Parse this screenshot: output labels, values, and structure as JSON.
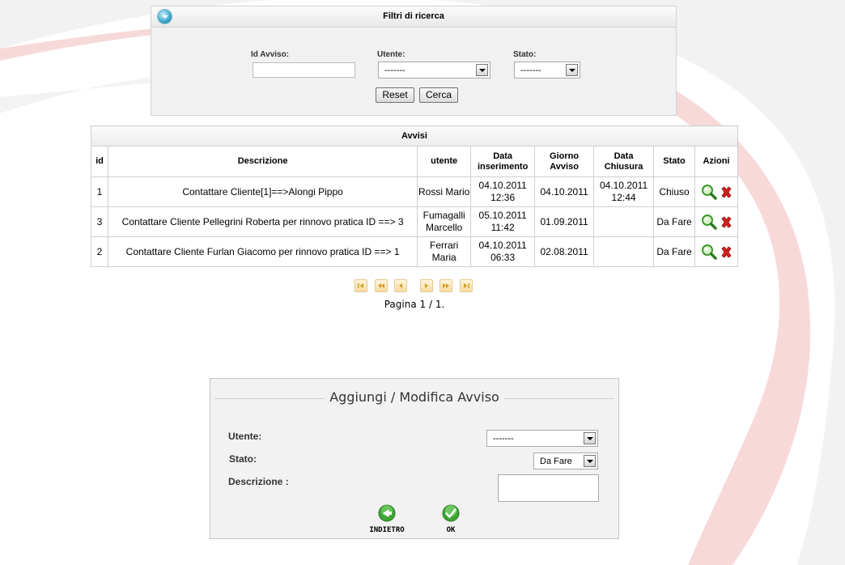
{
  "filters": {
    "title": "Filtri di ricerca",
    "id_label": "Id Avviso:",
    "id_value": "",
    "utente_label": "Utente:",
    "utente_value": "-------",
    "stato_label": "Stato:",
    "stato_value": "-------",
    "reset_label": "Reset",
    "cerca_label": "Cerca"
  },
  "table": {
    "caption": "Avvisi",
    "columns": [
      "id",
      "Descrizione",
      "utente",
      "Data inserimento",
      "Giorno Avviso",
      "Data Chiusura",
      "Stato",
      "Azioni"
    ],
    "rows": [
      {
        "id": "1",
        "descrizione": "Contattare Cliente[1]==>Alongi Pippo",
        "utente": "Rossi Mario",
        "data_inserimento": "04.10.2011 12:36",
        "giorno_avviso": "04.10.2011",
        "data_chiusura": "04.10.2011 12:44",
        "stato": "Chiuso"
      },
      {
        "id": "3",
        "descrizione": "Contattare Cliente Pellegrini Roberta per rinnovo pratica ID ==> 3",
        "utente": "Fumagalli Marcello",
        "data_inserimento": "05.10.2011 11:42",
        "giorno_avviso": "01.09.2011",
        "data_chiusura": "",
        "stato": "Da Fare"
      },
      {
        "id": "2",
        "descrizione": "Contattare Cliente Furlan Giacomo per rinnovo pratica ID ==> 1",
        "utente": "Ferrari Maria",
        "data_inserimento": "04.10.2011 06:33",
        "giorno_avviso": "02.08.2011",
        "data_chiusura": "",
        "stato": "Da Fare"
      }
    ],
    "action_icons": [
      "magnifier-icon",
      "delete-x-icon"
    ]
  },
  "pager": {
    "buttons": [
      "first-page-icon",
      "prev-block-icon",
      "prev-page-icon",
      "next-page-icon",
      "next-block-icon",
      "last-page-icon"
    ],
    "info": "Pagina 1 / 1."
  },
  "form": {
    "legend": "Aggiungi / Modifica Avviso",
    "utente_label": "Utente:",
    "utente_value": "-------",
    "stato_label": "Stato:",
    "stato_value": "Da Fare",
    "descrizione_label": "Descrizione :",
    "descrizione_value": "",
    "back_label": "INDIETRO",
    "ok_label": "OK"
  },
  "colors": {
    "accent_gold": "#f7dca0",
    "back_green": "#3fa535",
    "delete_red": "#d42020",
    "bg_swoosh_red": "#f7d7d7",
    "bg_swoosh_gray": "#e6e6e6"
  }
}
